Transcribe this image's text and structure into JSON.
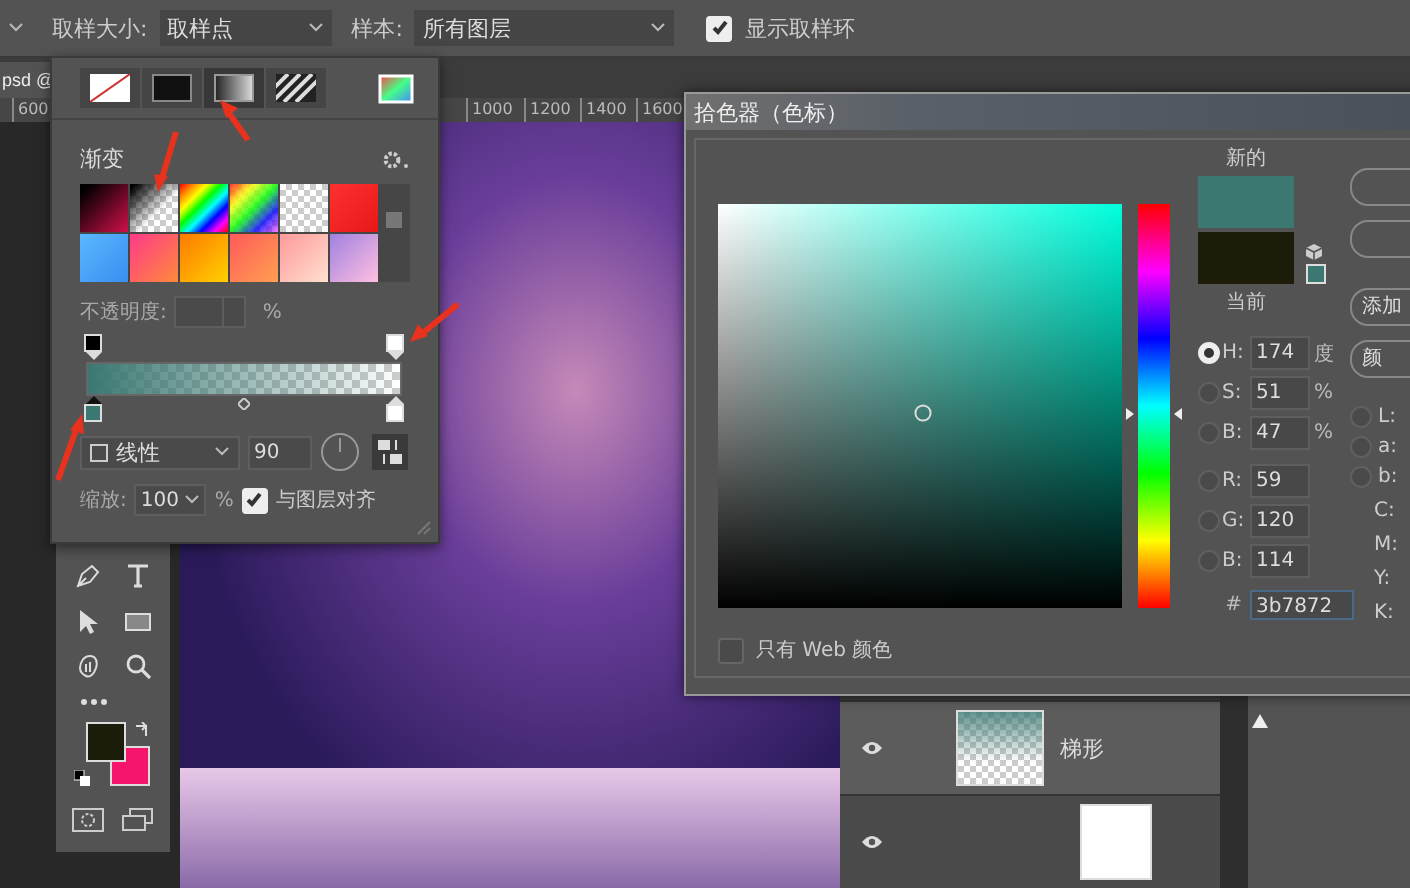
{
  "options_bar": {
    "sample_size": {
      "label": "取样大小:",
      "value": "取样点"
    },
    "sample": {
      "label": "样本:",
      "value": "所有图层"
    },
    "show_ring": {
      "label": "显示取样环",
      "checked": true
    }
  },
  "document_tab": {
    "title": "psd @"
  },
  "ruler": {
    "ticks": [
      "600",
      "1000",
      "1200",
      "1400",
      "1600"
    ]
  },
  "gradient_popup": {
    "fill_types": [
      {
        "kind": "none",
        "selected": false
      },
      {
        "kind": "solid",
        "selected": false
      },
      {
        "kind": "gradient",
        "selected": true
      },
      {
        "kind": "pattern",
        "selected": false
      }
    ],
    "heading": "渐变",
    "opacity": {
      "label": "不透明度:",
      "unit": "%"
    },
    "opacity_stops": [
      {
        "color": "#000000",
        "selected": false
      },
      {
        "color": "#ffffff",
        "selected": false
      }
    ],
    "color_stops": [
      {
        "color": "#3b7872",
        "selected": true
      },
      {
        "color": "#ffffff",
        "selected": false
      }
    ],
    "style": {
      "value": "线性"
    },
    "angle": "90",
    "scale": {
      "label": "缩放:",
      "value": "100",
      "unit": "%"
    },
    "align": {
      "label": "与图层对齐",
      "checked": true
    }
  },
  "toolbar": {
    "colors": [
      {
        "color": "#1c1c0a"
      },
      {
        "color": "#f5156a"
      }
    ]
  },
  "color_picker": {
    "title": "拾色器（色标）",
    "swatches": [
      {
        "label": "新的",
        "color": "#3b7872"
      },
      {
        "label": "当前",
        "color": "#1c1c08"
      }
    ],
    "hue_slider": {
      "level": 0.48
    },
    "buttons": [
      "添加",
      "颜"
    ],
    "fields": [
      {
        "label": "H:",
        "value": "174",
        "unit": "度",
        "selected": true
      },
      {
        "label": "S:",
        "value": "51",
        "unit": "%",
        "selected": false
      },
      {
        "label": "B:",
        "value": "47",
        "unit": "%",
        "selected": false
      },
      {
        "label": "R:",
        "value": "59",
        "selected": false
      },
      {
        "label": "G:",
        "value": "120",
        "selected": false
      },
      {
        "label": "B:",
        "value": "114",
        "selected": false
      }
    ],
    "lab": [
      {
        "label": "L:",
        "selected": false
      },
      {
        "label": "a:",
        "selected": false
      },
      {
        "label": "b:",
        "selected": false
      }
    ],
    "cmyk": [
      "C:",
      "M:",
      "Y:",
      "K:"
    ],
    "hex": {
      "label": "#",
      "value": "3b7872"
    },
    "web_only": {
      "label": "只有 Web 颜色",
      "checked": false
    }
  },
  "layers": [
    {
      "name": "梯形",
      "selected": true,
      "visible": true
    },
    {
      "selected": false,
      "visible": true
    }
  ]
}
